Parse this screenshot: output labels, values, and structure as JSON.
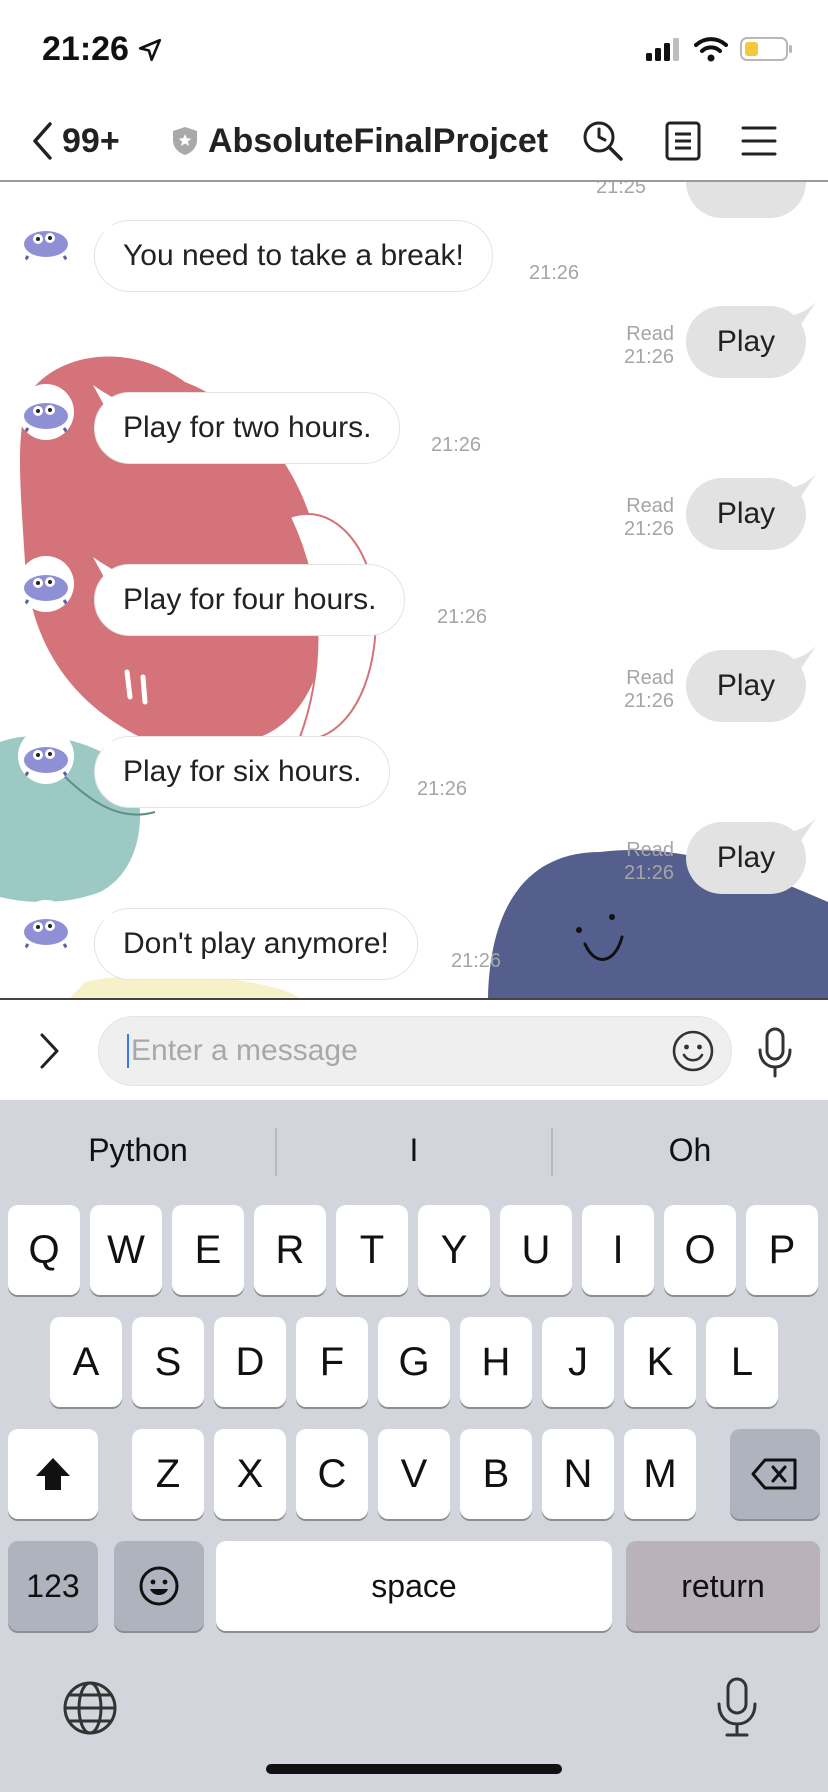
{
  "status_bar": {
    "time": "21:26"
  },
  "header": {
    "back_count": "99+",
    "title": "AbsoluteFinalProjcet"
  },
  "messages": [
    {
      "side": "left",
      "text": "You need to take a break!",
      "time": "21:26"
    },
    {
      "side": "right",
      "text": "Play",
      "read": "Read",
      "time": "21:26"
    },
    {
      "side": "left",
      "text": "Play for two hours.",
      "time": "21:26"
    },
    {
      "side": "right",
      "text": "Play",
      "read": "Read",
      "time": "21:26"
    },
    {
      "side": "left",
      "text": "Play for four hours.",
      "time": "21:26"
    },
    {
      "side": "right",
      "text": "Play",
      "read": "Read",
      "time": "21:26"
    },
    {
      "side": "left",
      "text": "Play for six hours.",
      "time": "21:26"
    },
    {
      "side": "right",
      "text": "Play",
      "read": "Read",
      "time": "21:26"
    },
    {
      "side": "left",
      "text": "Don't play anymore!",
      "time": "21:26"
    }
  ],
  "partial_top": {
    "time": "21:25"
  },
  "input": {
    "placeholder": "Enter a message"
  },
  "keyboard": {
    "suggestions": [
      "Python",
      "I",
      "Oh"
    ],
    "row1": [
      "Q",
      "W",
      "E",
      "R",
      "T",
      "Y",
      "U",
      "I",
      "O",
      "P"
    ],
    "row2": [
      "A",
      "S",
      "D",
      "F",
      "G",
      "H",
      "J",
      "K",
      "L"
    ],
    "row3": [
      "Z",
      "X",
      "C",
      "V",
      "B",
      "N",
      "M"
    ],
    "numbers_key": "123",
    "space_key": "space",
    "return_key": "return"
  },
  "colors": {
    "decor_pink": "#d4747a",
    "decor_teal": "#9cc9c3",
    "decor_navy": "#545f8e",
    "my_bubble": "#e2e2e2",
    "keyboard_bg": "#d3d5dc"
  }
}
